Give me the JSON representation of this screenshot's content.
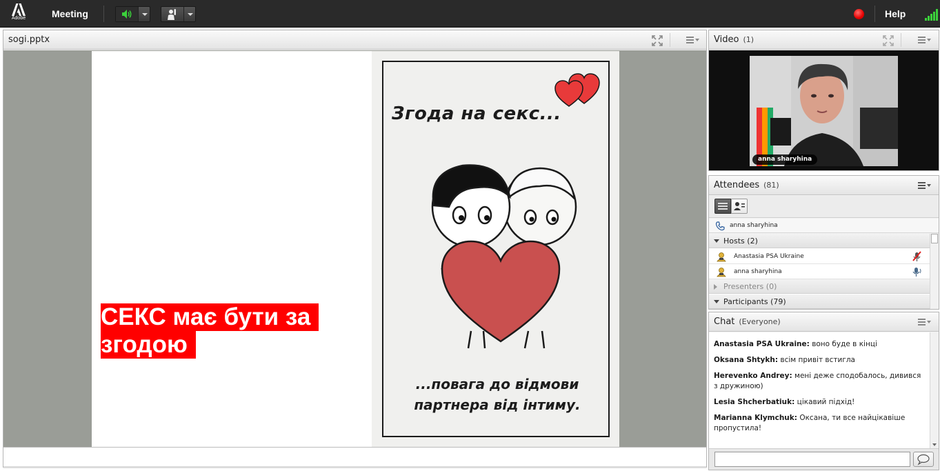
{
  "topbar": {
    "logo_text": "Adobe",
    "menu_meeting": "Meeting",
    "help": "Help",
    "colors": {
      "speaker_active": "#3bd13b",
      "record": "#e60000",
      "signal": "#3bd13b"
    }
  },
  "share_pod": {
    "title": "sogi.pptx",
    "slide": {
      "headline": "СЕКС має бути за згодою",
      "poster_title": "Згода на секс...",
      "poster_caption_line1": "...повага до відмови",
      "poster_caption_line2": "партнера від інтиму.",
      "colors": {
        "headline_bg": "#ff0000",
        "heart": "#c9504f"
      }
    }
  },
  "video_pod": {
    "title": "Video",
    "count": "(1)",
    "name_tag": "anna sharyhina"
  },
  "attendees_pod": {
    "title": "Attendees",
    "count": "(81)",
    "voice_user": "anna sharyhina",
    "groups": {
      "hosts": {
        "label": "Hosts (2)",
        "members": [
          "Anastasia PSA Ukraine",
          "anna sharyhina"
        ]
      },
      "presenters": {
        "label": "Presenters (0)"
      },
      "participants": {
        "label": "Participants (79)"
      }
    }
  },
  "chat_pod": {
    "title": "Chat",
    "scope": "(Everyone)",
    "messages": [
      {
        "from": "Anastasia PSA Ukraine:",
        "text": "воно буде в кінці"
      },
      {
        "from": "Oksana Shtykh:",
        "text": "всім привіт   встигла"
      },
      {
        "from": "Herevenko Andrey:",
        "text": "мені деже сподобалось, дивився з дружиною)"
      },
      {
        "from": "Lesia Shcherbatiuk:",
        "text": "цікавий підхід!"
      },
      {
        "from": "Marianna Klymchuk:",
        "text": "Оксана, ти все найцікавіше пропустила!"
      }
    ],
    "input_value": ""
  }
}
